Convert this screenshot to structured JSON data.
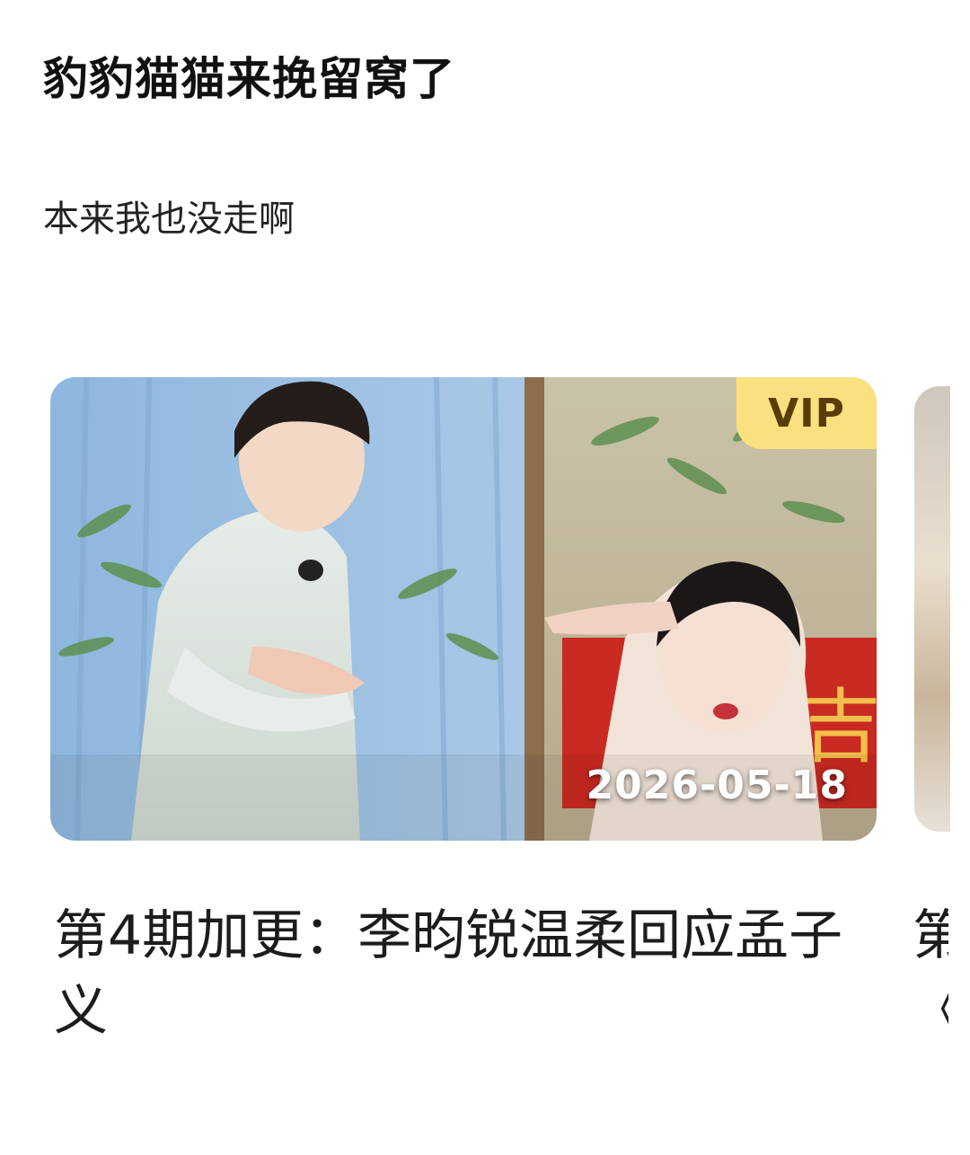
{
  "post": {
    "title": "豹豹猫猫来挽留窝了",
    "body": "本来我也没走啊"
  },
  "video_card": {
    "badge": "VIP",
    "date": "2026-05-18",
    "title": "第4期加更：李昀锐温柔回应孟子义",
    "thumbnail_sign_text": "吉"
  },
  "next_card": {
    "title_peek": "第\n《"
  },
  "colors": {
    "vip_badge_bg": "#fbe07f",
    "vip_badge_text": "#5a3b0a",
    "title_text": "#111111",
    "body_text": "#222222"
  }
}
